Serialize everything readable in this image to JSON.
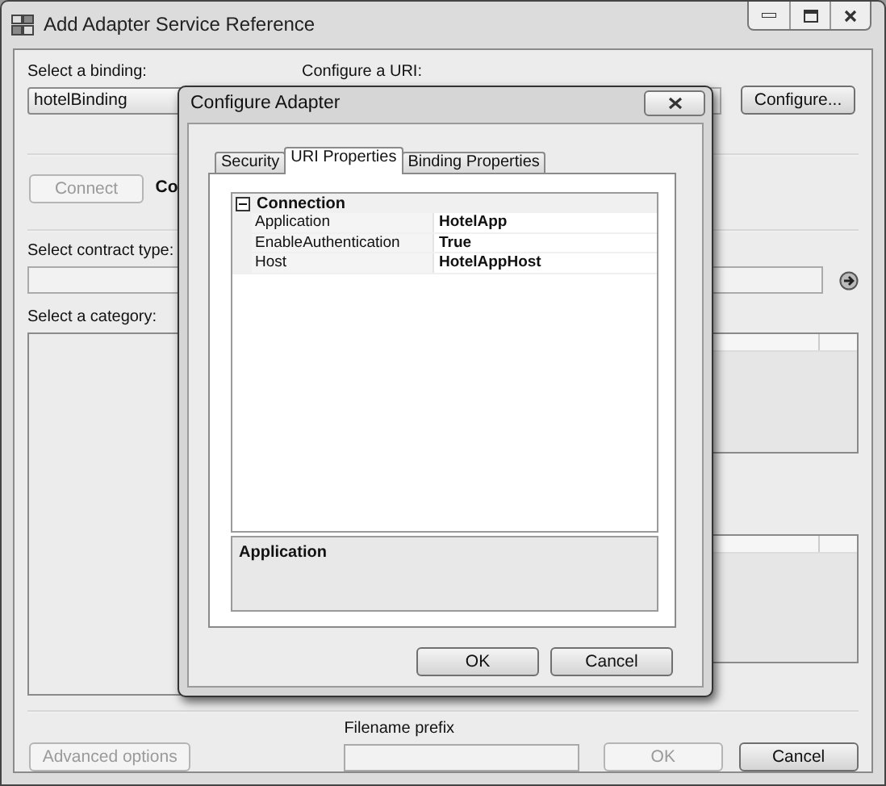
{
  "window": {
    "title": "Add Adapter Service Reference"
  },
  "binding": {
    "label": "Select a binding:",
    "value": "hotelBinding"
  },
  "uri": {
    "label": "Configure a URI:",
    "button": {
      "label": "Configure...",
      "disabled": false
    }
  },
  "connect": {
    "button": {
      "label": "Connect",
      "disabled": true
    },
    "status": "Co"
  },
  "contract": {
    "label": "Select contract type:"
  },
  "category": {
    "label": "Select a category:"
  },
  "footer": {
    "prefix_label": "Filename prefix",
    "buttons": [
      {
        "kind": "advanced",
        "label": "Advanced options",
        "disabled": true
      },
      {
        "kind": "ok",
        "label": "OK",
        "disabled": true
      },
      {
        "kind": "cancel",
        "label": "Cancel",
        "disabled": false
      }
    ]
  },
  "dialog": {
    "title": "Configure Adapter",
    "tabs": [
      {
        "label": "Security",
        "selected": false
      },
      {
        "label": "URI Properties",
        "selected": true
      },
      {
        "label": "Binding Properties",
        "selected": false
      }
    ],
    "grid": {
      "category": "Connection",
      "expanded": true,
      "rows": [
        {
          "name": "Application",
          "value": "HotelApp"
        },
        {
          "name": "EnableAuthentication",
          "value": "True"
        },
        {
          "name": "Host",
          "value": "HotelAppHost"
        }
      ]
    },
    "description": "Application",
    "buttons": [
      "OK",
      "Cancel"
    ]
  }
}
